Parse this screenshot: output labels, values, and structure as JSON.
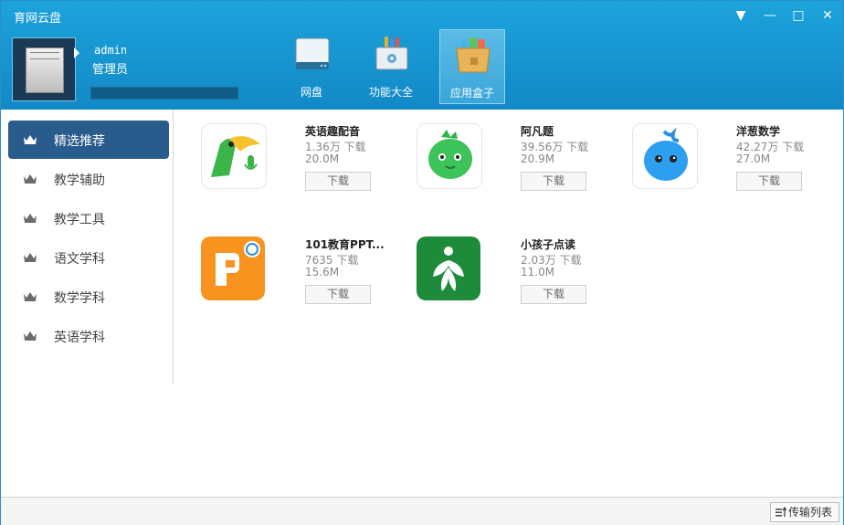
{
  "window": {
    "title": "育网云盘",
    "controls": {
      "menu": "▼",
      "minimize": "—",
      "maximize": "□",
      "close": "✕"
    }
  },
  "user": {
    "name": "admin",
    "role": "管理员",
    "quota_fraction": 1.0
  },
  "nav": [
    {
      "label": "网盘",
      "icon": "disk-icon"
    },
    {
      "label": "功能大全",
      "icon": "toolbox-icon"
    },
    {
      "label": "应用盒子",
      "icon": "app-box-icon",
      "active": true
    }
  ],
  "sidebar": {
    "items": [
      {
        "label": "精选推荐",
        "active": true
      },
      {
        "label": "教学辅助"
      },
      {
        "label": "教学工具"
      },
      {
        "label": "语文学科"
      },
      {
        "label": "数学学科"
      },
      {
        "label": "英语学科"
      }
    ]
  },
  "apps": [
    {
      "name": "英语趣配音",
      "downloads": "1.36万 下载",
      "size": "20.0M",
      "button": "下载",
      "icon": "parrot-icon"
    },
    {
      "name": "阿凡题",
      "downloads": "39.56万 下载",
      "size": "20.9M",
      "button": "下载",
      "icon": "green-dino-icon"
    },
    {
      "name": "洋葱数学",
      "downloads": "42.27万 下载",
      "size": "27.0M",
      "button": "下载",
      "icon": "blue-onion-icon"
    },
    {
      "name": "101教育PPT...",
      "downloads": "7635 下载",
      "size": "15.6M",
      "button": "下载",
      "icon": "orange-p-icon"
    },
    {
      "name": "小孩子点读",
      "downloads": "2.03万 下载",
      "size": "11.0M",
      "button": "下载",
      "icon": "green-leaf-person-icon"
    }
  ],
  "status": {
    "transfer_label": "传输列表"
  },
  "colors": {
    "titlebar": "#1a9ad6",
    "sidebar_active": "#2a5b8d"
  }
}
